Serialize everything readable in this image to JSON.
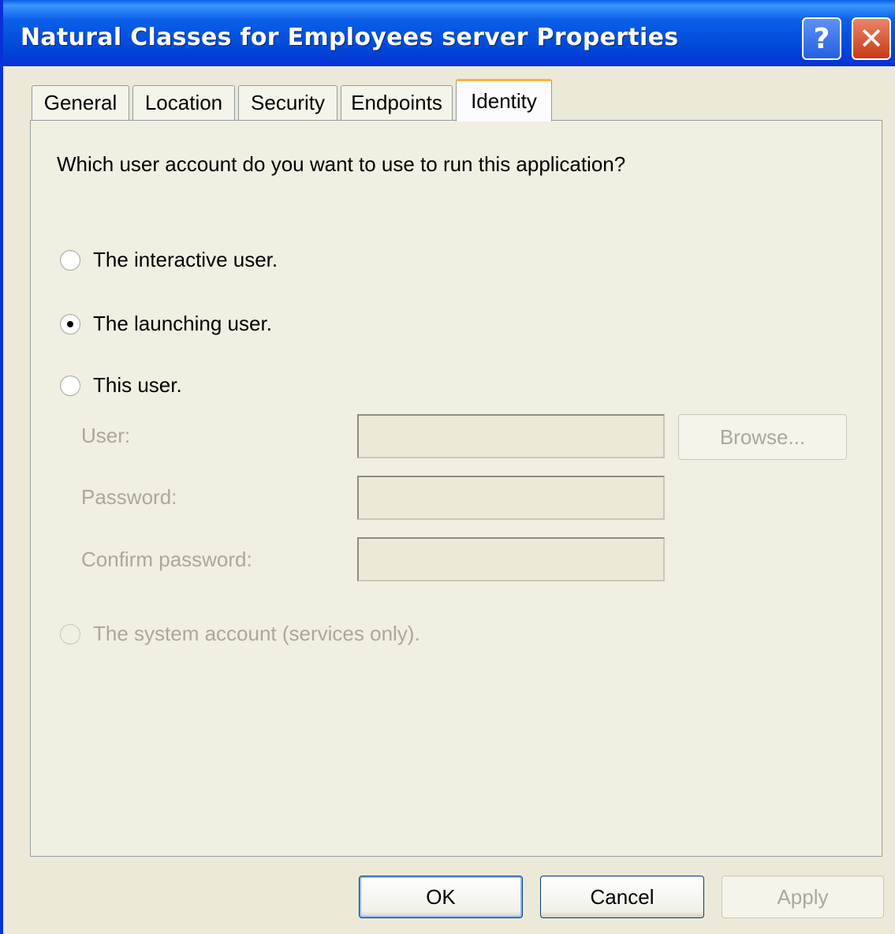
{
  "window": {
    "title": "Natural Classes for Employees server Properties",
    "help_glyph": "?",
    "close_glyph": "✕"
  },
  "tabs": [
    {
      "label": "General",
      "active": false
    },
    {
      "label": "Location",
      "active": false
    },
    {
      "label": "Security",
      "active": false
    },
    {
      "label": "Endpoints",
      "active": false
    },
    {
      "label": "Identity",
      "active": true
    }
  ],
  "identity": {
    "question": "Which user account do you want to use to run this application?",
    "options": [
      {
        "label": "The interactive user.",
        "selected": false,
        "enabled": true
      },
      {
        "label": "The launching user.",
        "selected": true,
        "enabled": true
      },
      {
        "label": "This user.",
        "selected": false,
        "enabled": true
      },
      {
        "label": "The system account (services only).",
        "selected": false,
        "enabled": false
      }
    ],
    "fields": {
      "user_label": "User:",
      "user_value": "",
      "password_label": "Password:",
      "password_value": "",
      "confirm_label": "Confirm password:",
      "confirm_value": ""
    },
    "browse_label": "Browse..."
  },
  "buttons": {
    "ok": "OK",
    "cancel": "Cancel",
    "apply": "Apply"
  },
  "colors": {
    "titlebar": "#0A5FE8",
    "dialog_bg": "#ECE9D8",
    "active_tab_accent": "#F9B23C",
    "disabled_text": "#ACA899"
  }
}
